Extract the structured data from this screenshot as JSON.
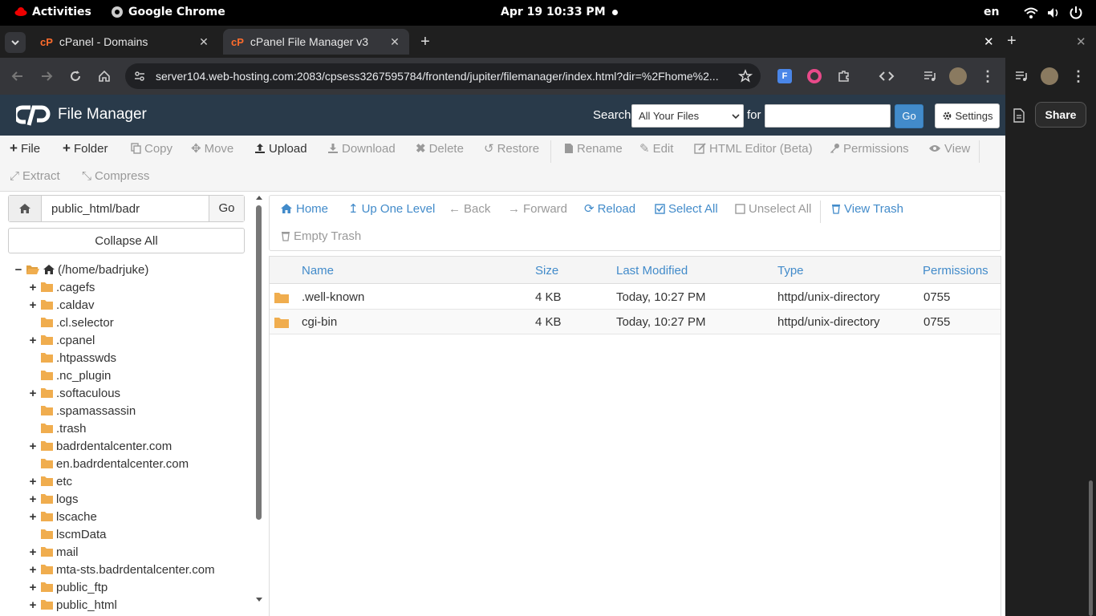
{
  "os": {
    "activities": "Activities",
    "app_name": "Google Chrome",
    "clock": "Apr 19  10:33 PM",
    "language": "en"
  },
  "browser": {
    "tabs": [
      {
        "title": "cPanel - Domains",
        "active": false
      },
      {
        "title": "cPanel File Manager v3",
        "active": true
      }
    ],
    "url": "server104.web-hosting.com:2083/cpsess3267595784/frontend/jupiter/filemanager/index.html?dir=%2Fhome%2...",
    "side_panel": {
      "share_label": "Share"
    }
  },
  "header": {
    "app_title": "File Manager",
    "search_label": "Search",
    "search_scope": "All Your Files",
    "for_label": "for",
    "search_value": "",
    "go_label": "Go",
    "settings_label": "Settings"
  },
  "toolbar": {
    "file": "File",
    "folder": "Folder",
    "copy": "Copy",
    "move": "Move",
    "upload": "Upload",
    "download": "Download",
    "delete": "Delete",
    "restore": "Restore",
    "rename": "Rename",
    "edit": "Edit",
    "html_editor": "HTML Editor (Beta)",
    "permissions": "Permissions",
    "view": "View",
    "extract": "Extract",
    "compress": "Compress"
  },
  "sidebar": {
    "path_value": "public_html/badr",
    "go_label": "Go",
    "collapse_label": "Collapse All",
    "root_label": "(/home/badrjuke)",
    "tree": [
      {
        "label": ".cagefs",
        "expandable": true
      },
      {
        "label": ".caldav",
        "expandable": true
      },
      {
        "label": ".cl.selector",
        "expandable": false
      },
      {
        "label": ".cpanel",
        "expandable": true
      },
      {
        "label": ".htpasswds",
        "expandable": false
      },
      {
        "label": ".nc_plugin",
        "expandable": false
      },
      {
        "label": ".softaculous",
        "expandable": true
      },
      {
        "label": ".spamassassin",
        "expandable": false
      },
      {
        "label": ".trash",
        "expandable": false
      },
      {
        "label": "badrdentalcenter.com",
        "expandable": true
      },
      {
        "label": "en.badrdentalcenter.com",
        "expandable": false
      },
      {
        "label": "etc",
        "expandable": true
      },
      {
        "label": "logs",
        "expandable": true
      },
      {
        "label": "lscache",
        "expandable": true
      },
      {
        "label": "lscmData",
        "expandable": false
      },
      {
        "label": "mail",
        "expandable": true
      },
      {
        "label": "mta-sts.badrdentalcenter.com",
        "expandable": true
      },
      {
        "label": "public_ftp",
        "expandable": true
      },
      {
        "label": "public_html",
        "expandable": true
      }
    ]
  },
  "nav": {
    "home": "Home",
    "up_one_level": "Up One Level",
    "back": "Back",
    "forward": "Forward",
    "reload": "Reload",
    "select_all": "Select All",
    "unselect_all": "Unselect All",
    "view_trash": "View Trash",
    "empty_trash": "Empty Trash"
  },
  "table": {
    "columns": [
      "Name",
      "Size",
      "Last Modified",
      "Type",
      "Permissions"
    ],
    "rows": [
      {
        "name": ".well-known",
        "size": "4 KB",
        "modified": "Today, 10:27 PM",
        "type": "httpd/unix-directory",
        "perms": "0755"
      },
      {
        "name": "cgi-bin",
        "size": "4 KB",
        "modified": "Today, 10:27 PM",
        "type": "httpd/unix-directory",
        "perms": "0755"
      }
    ]
  },
  "colors": {
    "header_bg": "#293a4a",
    "link": "#428bca",
    "folder": "#f0ad4e"
  }
}
